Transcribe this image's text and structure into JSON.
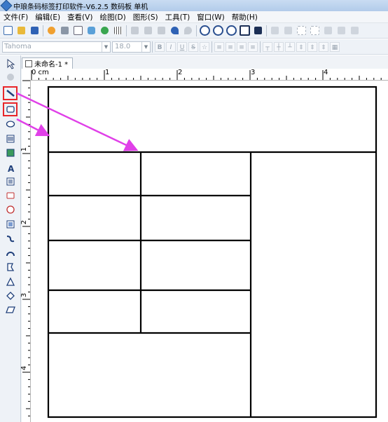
{
  "window": {
    "title": "中琅条码标签打印软件-V6.2.5 数码板 单机"
  },
  "menu": [
    {
      "label": "文件(F)"
    },
    {
      "label": "编辑(E)"
    },
    {
      "label": "查看(V)"
    },
    {
      "label": "绘图(D)"
    },
    {
      "label": "图形(S)"
    },
    {
      "label": "工具(T)"
    },
    {
      "label": "窗口(W)"
    },
    {
      "label": "帮助(H)"
    }
  ],
  "format_bar": {
    "font_name": "Tahoma",
    "font_size": "18.0",
    "bold_label": "B",
    "italic_label": "I",
    "underline_label": "U",
    "strike_label": "S"
  },
  "document": {
    "tab_title": "未命名-1 *"
  },
  "ruler": {
    "h_labels": [
      {
        "text": "0 cm"
      },
      {
        "text": "1"
      },
      {
        "text": "2"
      },
      {
        "text": "3"
      },
      {
        "text": "4"
      }
    ],
    "v_labels": [
      {
        "text": "1"
      },
      {
        "text": "2"
      },
      {
        "text": "3"
      },
      {
        "text": "4"
      }
    ]
  },
  "left_tools": [
    {
      "icon": "select-arrow-icon",
      "highlighted": false
    },
    {
      "icon": "hand-pan-icon",
      "highlighted": false
    },
    {
      "icon": "line-tool-icon",
      "highlighted": true
    },
    {
      "icon": "rectangle-tool-icon",
      "highlighted": true
    },
    {
      "icon": "ellipse-tool-icon",
      "highlighted": false
    },
    {
      "icon": "barcode-tool-icon",
      "highlighted": false
    },
    {
      "icon": "image-tool-icon",
      "highlighted": false
    },
    {
      "icon": "text-tool-icon",
      "highlighted": false,
      "glyph": "A"
    },
    {
      "icon": "rich-text-tool-icon",
      "highlighted": false
    },
    {
      "icon": "data-tool-icon",
      "highlighted": false
    },
    {
      "icon": "shape-tool-icon",
      "highlighted": false
    },
    {
      "icon": "grid-tool-icon",
      "highlighted": false
    },
    {
      "icon": "curve-tool-icon",
      "highlighted": false
    },
    {
      "icon": "arc-tool-icon",
      "highlighted": false
    },
    {
      "icon": "polygon-tool-icon",
      "highlighted": false
    },
    {
      "icon": "triangle-tool-icon",
      "highlighted": false
    },
    {
      "icon": "diamond-tool-icon",
      "highlighted": false
    },
    {
      "icon": "parallelogram-tool-icon",
      "highlighted": false
    }
  ],
  "colors": {
    "highlight_border": "#e8262a",
    "annotation_arrow": "#e040e8",
    "table_line": "#000000"
  }
}
